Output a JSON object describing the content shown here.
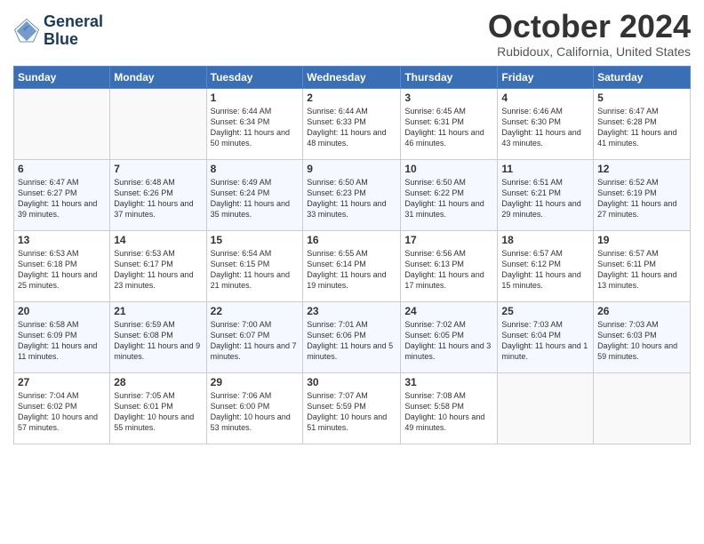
{
  "logo": {
    "line1": "General",
    "line2": "Blue"
  },
  "title": "October 2024",
  "location": "Rubidoux, California, United States",
  "headers": [
    "Sunday",
    "Monday",
    "Tuesday",
    "Wednesday",
    "Thursday",
    "Friday",
    "Saturday"
  ],
  "weeks": [
    [
      {
        "day": "",
        "sunrise": "",
        "sunset": "",
        "daylight": "",
        "empty": true
      },
      {
        "day": "",
        "sunrise": "",
        "sunset": "",
        "daylight": "",
        "empty": true
      },
      {
        "day": "1",
        "sunrise": "Sunrise: 6:44 AM",
        "sunset": "Sunset: 6:34 PM",
        "daylight": "Daylight: 11 hours and 50 minutes.",
        "empty": false
      },
      {
        "day": "2",
        "sunrise": "Sunrise: 6:44 AM",
        "sunset": "Sunset: 6:33 PM",
        "daylight": "Daylight: 11 hours and 48 minutes.",
        "empty": false
      },
      {
        "day": "3",
        "sunrise": "Sunrise: 6:45 AM",
        "sunset": "Sunset: 6:31 PM",
        "daylight": "Daylight: 11 hours and 46 minutes.",
        "empty": false
      },
      {
        "day": "4",
        "sunrise": "Sunrise: 6:46 AM",
        "sunset": "Sunset: 6:30 PM",
        "daylight": "Daylight: 11 hours and 43 minutes.",
        "empty": false
      },
      {
        "day": "5",
        "sunrise": "Sunrise: 6:47 AM",
        "sunset": "Sunset: 6:28 PM",
        "daylight": "Daylight: 11 hours and 41 minutes.",
        "empty": false
      }
    ],
    [
      {
        "day": "6",
        "sunrise": "Sunrise: 6:47 AM",
        "sunset": "Sunset: 6:27 PM",
        "daylight": "Daylight: 11 hours and 39 minutes.",
        "empty": false
      },
      {
        "day": "7",
        "sunrise": "Sunrise: 6:48 AM",
        "sunset": "Sunset: 6:26 PM",
        "daylight": "Daylight: 11 hours and 37 minutes.",
        "empty": false
      },
      {
        "day": "8",
        "sunrise": "Sunrise: 6:49 AM",
        "sunset": "Sunset: 6:24 PM",
        "daylight": "Daylight: 11 hours and 35 minutes.",
        "empty": false
      },
      {
        "day": "9",
        "sunrise": "Sunrise: 6:50 AM",
        "sunset": "Sunset: 6:23 PM",
        "daylight": "Daylight: 11 hours and 33 minutes.",
        "empty": false
      },
      {
        "day": "10",
        "sunrise": "Sunrise: 6:50 AM",
        "sunset": "Sunset: 6:22 PM",
        "daylight": "Daylight: 11 hours and 31 minutes.",
        "empty": false
      },
      {
        "day": "11",
        "sunrise": "Sunrise: 6:51 AM",
        "sunset": "Sunset: 6:21 PM",
        "daylight": "Daylight: 11 hours and 29 minutes.",
        "empty": false
      },
      {
        "day": "12",
        "sunrise": "Sunrise: 6:52 AM",
        "sunset": "Sunset: 6:19 PM",
        "daylight": "Daylight: 11 hours and 27 minutes.",
        "empty": false
      }
    ],
    [
      {
        "day": "13",
        "sunrise": "Sunrise: 6:53 AM",
        "sunset": "Sunset: 6:18 PM",
        "daylight": "Daylight: 11 hours and 25 minutes.",
        "empty": false
      },
      {
        "day": "14",
        "sunrise": "Sunrise: 6:53 AM",
        "sunset": "Sunset: 6:17 PM",
        "daylight": "Daylight: 11 hours and 23 minutes.",
        "empty": false
      },
      {
        "day": "15",
        "sunrise": "Sunrise: 6:54 AM",
        "sunset": "Sunset: 6:15 PM",
        "daylight": "Daylight: 11 hours and 21 minutes.",
        "empty": false
      },
      {
        "day": "16",
        "sunrise": "Sunrise: 6:55 AM",
        "sunset": "Sunset: 6:14 PM",
        "daylight": "Daylight: 11 hours and 19 minutes.",
        "empty": false
      },
      {
        "day": "17",
        "sunrise": "Sunrise: 6:56 AM",
        "sunset": "Sunset: 6:13 PM",
        "daylight": "Daylight: 11 hours and 17 minutes.",
        "empty": false
      },
      {
        "day": "18",
        "sunrise": "Sunrise: 6:57 AM",
        "sunset": "Sunset: 6:12 PM",
        "daylight": "Daylight: 11 hours and 15 minutes.",
        "empty": false
      },
      {
        "day": "19",
        "sunrise": "Sunrise: 6:57 AM",
        "sunset": "Sunset: 6:11 PM",
        "daylight": "Daylight: 11 hours and 13 minutes.",
        "empty": false
      }
    ],
    [
      {
        "day": "20",
        "sunrise": "Sunrise: 6:58 AM",
        "sunset": "Sunset: 6:09 PM",
        "daylight": "Daylight: 11 hours and 11 minutes.",
        "empty": false
      },
      {
        "day": "21",
        "sunrise": "Sunrise: 6:59 AM",
        "sunset": "Sunset: 6:08 PM",
        "daylight": "Daylight: 11 hours and 9 minutes.",
        "empty": false
      },
      {
        "day": "22",
        "sunrise": "Sunrise: 7:00 AM",
        "sunset": "Sunset: 6:07 PM",
        "daylight": "Daylight: 11 hours and 7 minutes.",
        "empty": false
      },
      {
        "day": "23",
        "sunrise": "Sunrise: 7:01 AM",
        "sunset": "Sunset: 6:06 PM",
        "daylight": "Daylight: 11 hours and 5 minutes.",
        "empty": false
      },
      {
        "day": "24",
        "sunrise": "Sunrise: 7:02 AM",
        "sunset": "Sunset: 6:05 PM",
        "daylight": "Daylight: 11 hours and 3 minutes.",
        "empty": false
      },
      {
        "day": "25",
        "sunrise": "Sunrise: 7:03 AM",
        "sunset": "Sunset: 6:04 PM",
        "daylight": "Daylight: 11 hours and 1 minute.",
        "empty": false
      },
      {
        "day": "26",
        "sunrise": "Sunrise: 7:03 AM",
        "sunset": "Sunset: 6:03 PM",
        "daylight": "Daylight: 10 hours and 59 minutes.",
        "empty": false
      }
    ],
    [
      {
        "day": "27",
        "sunrise": "Sunrise: 7:04 AM",
        "sunset": "Sunset: 6:02 PM",
        "daylight": "Daylight: 10 hours and 57 minutes.",
        "empty": false
      },
      {
        "day": "28",
        "sunrise": "Sunrise: 7:05 AM",
        "sunset": "Sunset: 6:01 PM",
        "daylight": "Daylight: 10 hours and 55 minutes.",
        "empty": false
      },
      {
        "day": "29",
        "sunrise": "Sunrise: 7:06 AM",
        "sunset": "Sunset: 6:00 PM",
        "daylight": "Daylight: 10 hours and 53 minutes.",
        "empty": false
      },
      {
        "day": "30",
        "sunrise": "Sunrise: 7:07 AM",
        "sunset": "Sunset: 5:59 PM",
        "daylight": "Daylight: 10 hours and 51 minutes.",
        "empty": false
      },
      {
        "day": "31",
        "sunrise": "Sunrise: 7:08 AM",
        "sunset": "Sunset: 5:58 PM",
        "daylight": "Daylight: 10 hours and 49 minutes.",
        "empty": false
      },
      {
        "day": "",
        "sunrise": "",
        "sunset": "",
        "daylight": "",
        "empty": true
      },
      {
        "day": "",
        "sunrise": "",
        "sunset": "",
        "daylight": "",
        "empty": true
      }
    ]
  ]
}
